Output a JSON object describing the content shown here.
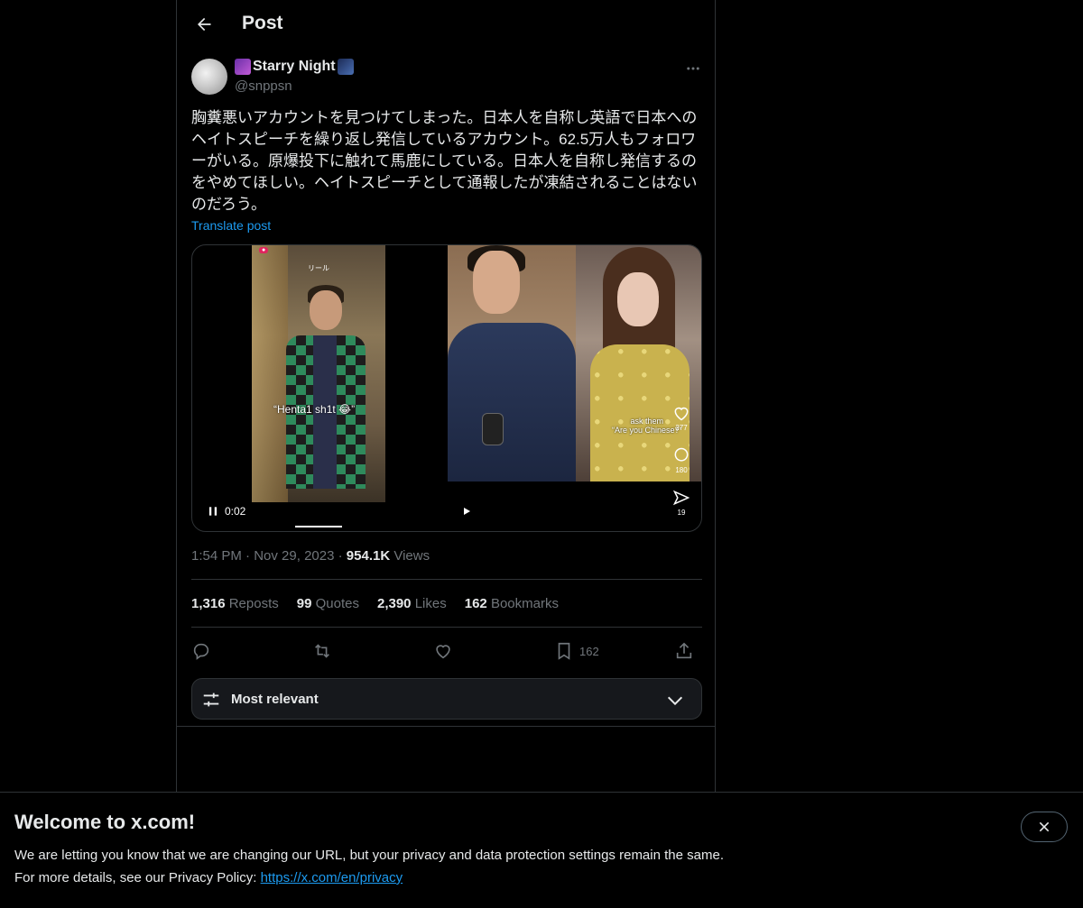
{
  "header": {
    "title": "Post"
  },
  "author": {
    "display_name": "Starry Night",
    "handle": "@snppsn"
  },
  "post": {
    "text": "胸糞悪いアカウントを見つけてしまった。日本人を自称し英語で日本への\nヘイトスピーチを繰り返し発信しているアカウント。62.5万人もフォロワ\nーがいる。原爆投下に触れて馬鹿にしている。日本人を自称し発信するの\nをやめてほしい。ヘイトスピーチとして通報したが凍結されることはない\nのだろう。",
    "translate_label": "Translate post",
    "time": "1:54 PM",
    "date": "Nov 29, 2023",
    "views_count": "954.1K",
    "views_label": "Views"
  },
  "video": {
    "current_time": "0:02",
    "left_caption": "“Henta1 sh1t 😂”",
    "reel_label": "リール",
    "right_caption": "ask them\n“Are you Chinese?”",
    "like_count": "277",
    "comment_count": "180",
    "share_count": "19",
    "progress_fraction": 0.18
  },
  "stats": {
    "reposts": {
      "count": "1,316",
      "label": "Reposts"
    },
    "quotes": {
      "count": "99",
      "label": "Quotes"
    },
    "likes": {
      "count": "2,390",
      "label": "Likes"
    },
    "bookmarks": {
      "count": "162",
      "label": "Bookmarks"
    }
  },
  "actions": {
    "bookmark_count": "162"
  },
  "sort": {
    "label": "Most relevant"
  },
  "banner": {
    "title": "Welcome to x.com!",
    "line1": "We are letting you know that we are changing our URL, but your privacy and data protection settings remain the same.",
    "line2": "For more details, see our Privacy Policy: ",
    "link": "https://x.com/en/privacy"
  },
  "colors": {
    "accent": "#1d9bf0",
    "background": "#000000",
    "border": "#2f3336",
    "muted_text": "#71767b"
  },
  "icons": [
    "back-arrow-icon",
    "more-icon",
    "pause-icon",
    "play-icon",
    "reply-icon",
    "repost-icon",
    "like-icon",
    "bookmark-icon",
    "share-icon",
    "sort-icon",
    "chevron-down-icon",
    "close-icon"
  ]
}
